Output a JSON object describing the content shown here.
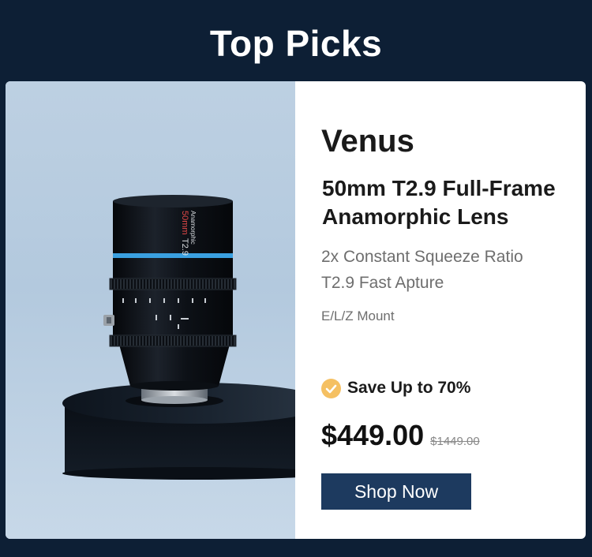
{
  "header": {
    "title": "Top Picks"
  },
  "product": {
    "brand": "Venus",
    "name": "50mm T2.9 Full-Frame Anamorphic Lens",
    "features": [
      "2x Constant Squeeze Ratio",
      "T2.9 Fast Apture"
    ],
    "mount": "E/L/Z Mount",
    "promo": "Save Up to 70%",
    "price": "$449.00",
    "original_price": "$1449.00",
    "cta_label": "Shop Now",
    "lens_markings": {
      "focal": "50mm",
      "aperture": "T2.9",
      "type": "Anamorphic"
    }
  },
  "colors": {
    "background": "#0d1f35",
    "button": "#1d3a5f",
    "check_badge": "#f5c062",
    "lens_accent": "#3aa0e0",
    "lens_focal_text": "#e04848"
  },
  "icons": {
    "promo_icon": "check-circle-icon"
  }
}
